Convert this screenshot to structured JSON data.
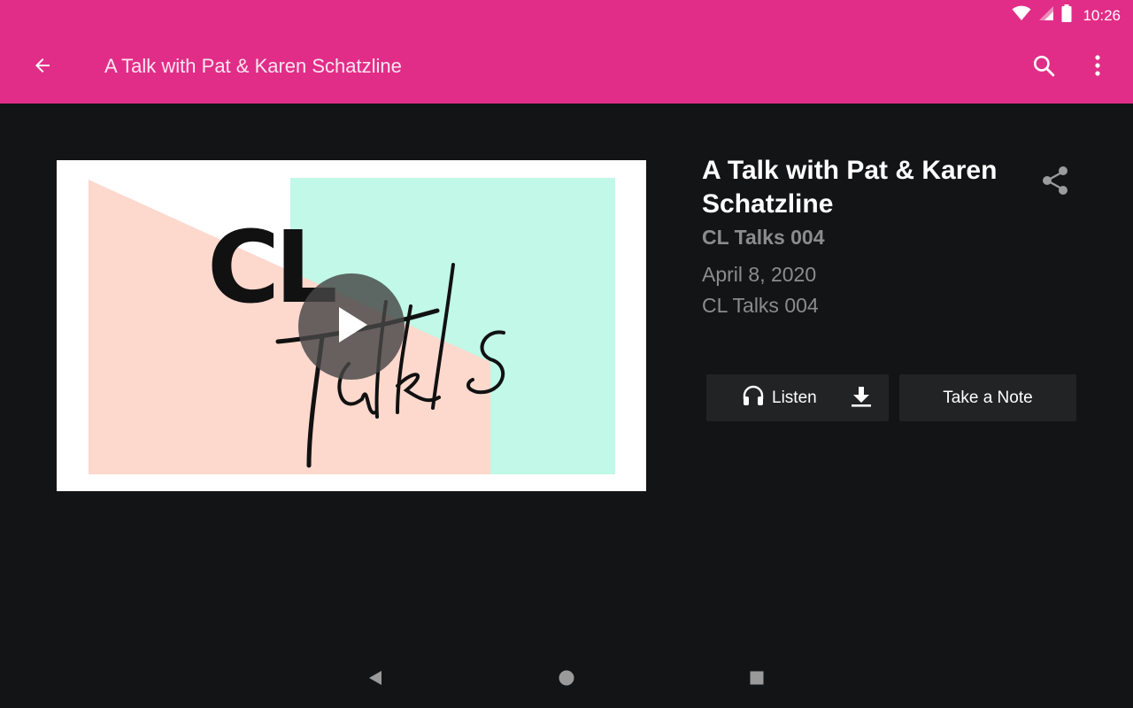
{
  "status_bar": {
    "time": "10:26",
    "icons": [
      "wifi-icon",
      "cell-signal-icon",
      "battery-icon"
    ]
  },
  "toolbar": {
    "title": "A Talk with Pat & Karen Schatzline",
    "back_icon": "arrow-back-icon",
    "search_icon": "search-icon",
    "more_icon": "more-vert-icon",
    "background_color": "#e12d87"
  },
  "media": {
    "thumbnail_text": "CL Talks",
    "play_icon": "play-icon"
  },
  "details": {
    "title": "A Talk with Pat & Karen Schatzline",
    "subtitle": "CL Talks 004",
    "date": "April 8, 2020",
    "series": "CL Talks 004",
    "share_icon": "share-icon"
  },
  "actions": {
    "listen_label": "Listen",
    "listen_icon": "headphones-icon",
    "download_icon": "download-icon",
    "note_label": "Take a Note"
  },
  "navigation_bar": {
    "icons": [
      "nav-back-icon",
      "nav-home-icon",
      "nav-recents-icon"
    ]
  },
  "colors": {
    "accent": "#e12d87",
    "background": "#131416",
    "button_bg": "#222325",
    "muted_text": "#8b8c8e",
    "thumb_pink": "#fdd8cd",
    "thumb_mint": "#c1f8e7"
  }
}
